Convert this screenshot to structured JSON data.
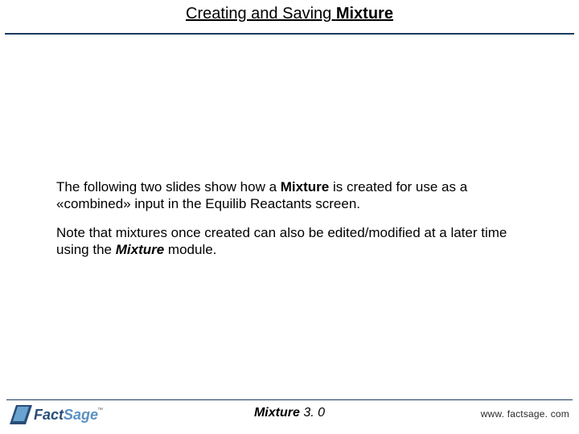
{
  "title": {
    "prefix": "Creating and Saving ",
    "mixture": "Mixture"
  },
  "body": {
    "p1a": "The following two slides show how a ",
    "p1b": "Mixture",
    "p1c": " is created for use as a «combined» input in the Equilib Reactants screen.",
    "p2a": "Note that mixtures once created can also be edited/modified at a later time using the ",
    "p2b": "Mixture",
    "p2c": " module."
  },
  "footer": {
    "center_word": "Mixture",
    "center_num": "  3. 0",
    "url": "www. factsage. com",
    "logo_text_fact": "Fact",
    "logo_text_sage": "Sage",
    "logo_tm": "™"
  }
}
